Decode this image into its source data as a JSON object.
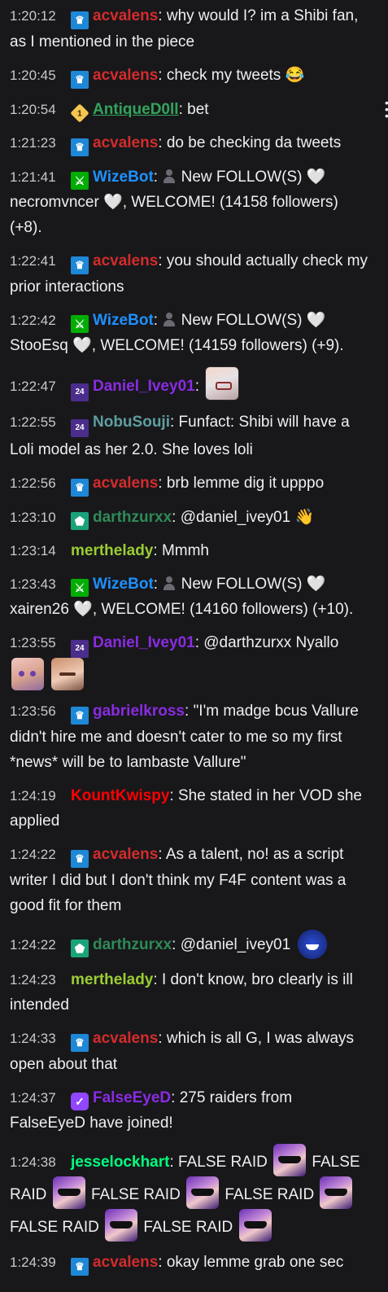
{
  "messages": [
    {
      "ts": "1:20:12",
      "badge": "crown",
      "user": "acvalens",
      "color": "#d22c2c",
      "text": "why would I? im a Shibi fan, as I mentioned in the piece"
    },
    {
      "ts": "1:20:45",
      "badge": "crown",
      "user": "acvalens",
      "color": "#d22c2c",
      "text": "check my tweets 😂"
    },
    {
      "ts": "1:20:54",
      "badge": "vip",
      "user": "AntiqueD0ll",
      "color": "#33a35a",
      "text": "bet"
    },
    {
      "ts": "1:21:23",
      "badge": "crown",
      "user": "acvalens",
      "color": "#d22c2c",
      "text": "do be checking da tweets"
    },
    {
      "ts": "1:21:41",
      "badge": "mod",
      "user": "WizeBot",
      "color": "#1e90ff",
      "pre": "New FOLLOW(S) 🤍 necromvncer 🤍, WELCOME! (14158 followers) (+8)."
    },
    {
      "ts": "1:22:41",
      "badge": "crown",
      "user": "acvalens",
      "color": "#d22c2c",
      "text": "you should actually check my prior interactions"
    },
    {
      "ts": "1:22:42",
      "badge": "mod",
      "user": "WizeBot",
      "color": "#1e90ff",
      "pre": "New FOLLOW(S) 🤍 StooEsq 🤍, WELCOME! (14159 followers) (+9)."
    },
    {
      "ts": "1:22:47",
      "badge": "sub",
      "user": "Daniel_Ivey01",
      "color": "#8a2be2",
      "text": ""
    },
    {
      "ts": "1:22:55",
      "badge": "sub",
      "user": "NobuSouji",
      "color": "#5f9ea0",
      "text": "Funfact: Shibi will have a Loli model as her 2.0. She loves loli"
    },
    {
      "ts": "1:22:56",
      "badge": "crown",
      "user": "acvalens",
      "color": "#d22c2c",
      "text": "brb lemme dig it upppo"
    },
    {
      "ts": "1:23:10",
      "badge": "gem",
      "user": "darthzurxx",
      "color": "#2e8b57",
      "text": "@daniel_ivey01 👋"
    },
    {
      "ts": "1:23:14",
      "badge": "",
      "user": "merthelady",
      "color": "#9acd32",
      "text": "Mmmh"
    },
    {
      "ts": "1:23:43",
      "badge": "mod",
      "user": "WizeBot",
      "color": "#1e90ff",
      "pre": "New FOLLOW(S) 🤍 xairen26 🤍, WELCOME! (14160 followers) (+10)."
    },
    {
      "ts": "1:23:55",
      "badge": "sub",
      "user": "Daniel_Ivey01",
      "color": "#8a2be2",
      "text": "@darthzurxx Nyallo"
    },
    {
      "ts": "1:23:56",
      "badge": "crown",
      "user": "gabrielkross",
      "color": "#8a2be2",
      "text": "\"I'm madge bcus Vallure didn't hire me and doesn't cater to me so my first *news* will be to lambaste Vallure\""
    },
    {
      "ts": "1:24:19",
      "badge": "",
      "user": "KountKwispy",
      "color": "#ff0000",
      "text": "She stated in her VOD she applied"
    },
    {
      "ts": "1:24:22",
      "badge": "crown",
      "user": "acvalens",
      "color": "#d22c2c",
      "text": "As a talent, no! as a script writer I did but I don't think my F4F content was a good fit for them"
    },
    {
      "ts": "1:24:22",
      "badge": "gem",
      "user": "darthzurxx",
      "color": "#2e8b57",
      "text": "@daniel_ivey01"
    },
    {
      "ts": "1:24:23",
      "badge": "",
      "user": "merthelady",
      "color": "#9acd32",
      "text": "I don't know, bro clearly is ill intended"
    },
    {
      "ts": "1:24:33",
      "badge": "crown",
      "user": "acvalens",
      "color": "#d22c2c",
      "text": "which is all G, I was always open about that"
    },
    {
      "ts": "1:24:37",
      "badge": "verified",
      "user": "FalseEyeD",
      "color": "#8a2be2",
      "text": "275 raiders from FalseEyeD have joined!"
    },
    {
      "ts": "1:24:38",
      "badge": "",
      "user": "jesselockhart",
      "color": "#00ff7f",
      "raid": "FALSE RAID"
    },
    {
      "ts": "1:24:39",
      "badge": "crown",
      "user": "acvalens",
      "color": "#d22c2c",
      "text": "okay lemme grab one sec"
    }
  ],
  "icons": {
    "crown": "crown-badge-icon",
    "vip": "vip-badge-icon",
    "mod": "moderator-sword-icon",
    "sub": "sub-24-badge-icon",
    "gem": "gem-badge-icon",
    "verified": "verified-check-icon"
  }
}
